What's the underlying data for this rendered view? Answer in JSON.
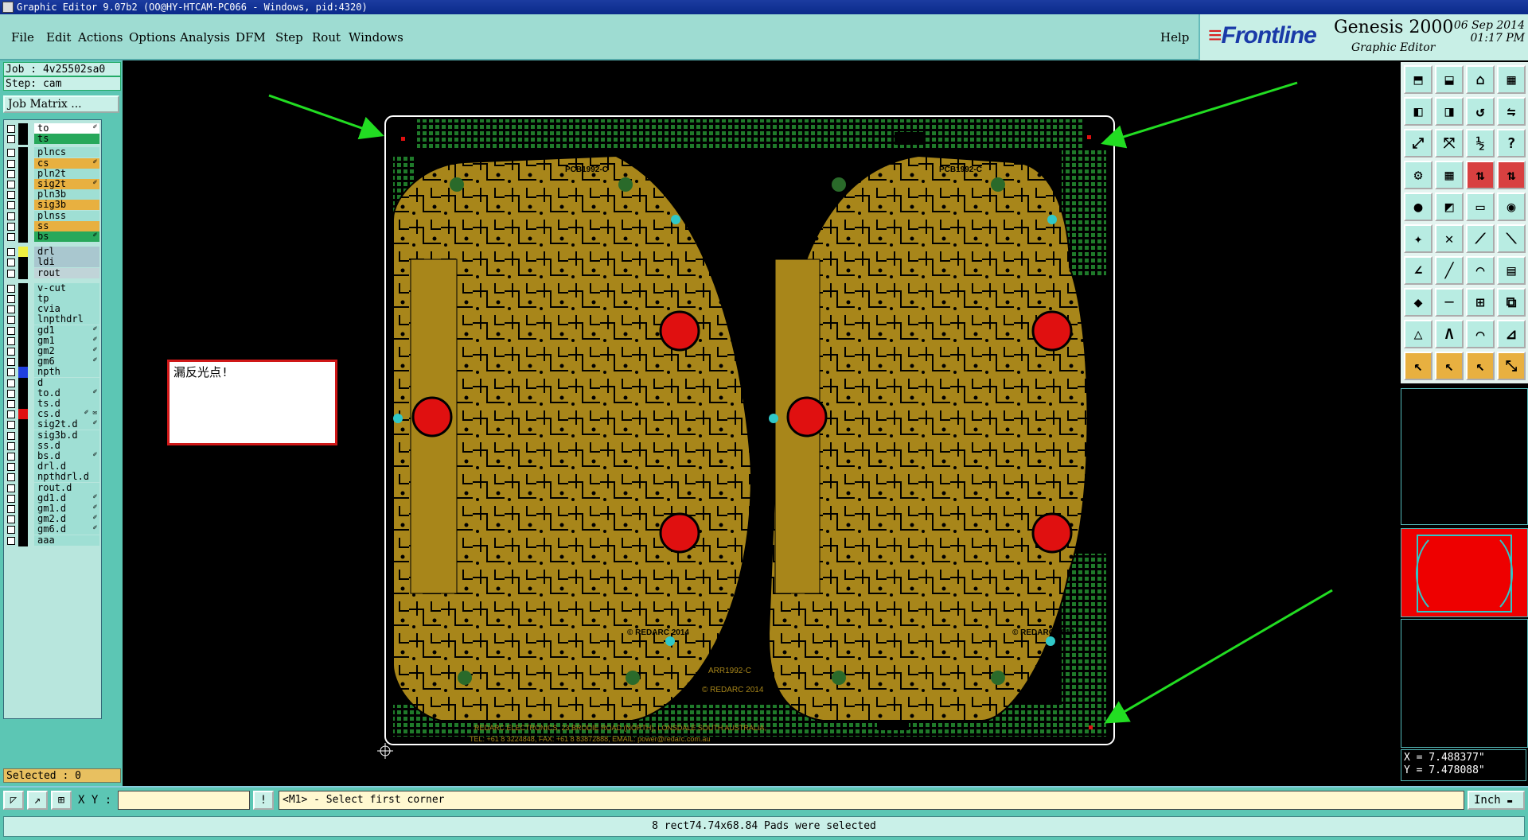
{
  "window": {
    "title": "Graphic Editor 9.07b2 (OO@HY-HTCAM-PC066 - Windows, pid:4320)"
  },
  "menu": {
    "items": [
      "File",
      "Edit",
      "Actions",
      "Options",
      "Analysis",
      "DFM",
      "Step",
      "Rout",
      "Windows"
    ],
    "help": "Help"
  },
  "brand": {
    "logo": "Frontline",
    "product": "Genesis 2000",
    "subtitle": "Graphic Editor",
    "date": "06 Sep 2014",
    "time": "01:17 PM"
  },
  "job": {
    "job_line": "Job : 4v25502sa0",
    "step_line": "Step: cam",
    "matrix_button": "Job Matrix ..."
  },
  "layers": [
    {
      "name": "to",
      "color": "#ffffff",
      "edit": "✐",
      "swatch": "#000000"
    },
    {
      "name": "ts",
      "color": "#27a85b",
      "edit": "",
      "swatch": "#000000"
    },
    {
      "name": "plncs",
      "color": "#9fdfd4",
      "edit": "",
      "swatch": "#000000"
    },
    {
      "name": "cs",
      "color": "#e8b040",
      "edit": "✐",
      "swatch": "#000000"
    },
    {
      "name": "pln2t",
      "color": "#9fdfd4",
      "edit": "",
      "swatch": "#000000"
    },
    {
      "name": "sig2t",
      "color": "#e8b040",
      "edit": "✐",
      "swatch": "#000000"
    },
    {
      "name": "pln3b",
      "color": "#9fdfd4",
      "edit": "",
      "swatch": "#000000"
    },
    {
      "name": "sig3b",
      "color": "#e8b040",
      "edit": "",
      "swatch": "#000000"
    },
    {
      "name": "plnss",
      "color": "#9fdfd4",
      "edit": "",
      "swatch": "#000000"
    },
    {
      "name": "ss",
      "color": "#e8b040",
      "edit": "",
      "swatch": "#000000"
    },
    {
      "name": "bs",
      "color": "#27a85b",
      "edit": "✐",
      "swatch": "#000000"
    },
    {
      "name": "drl",
      "color": "#a9c7cf",
      "edit": "",
      "swatch": "#f0f040"
    },
    {
      "name": "ldi",
      "color": "#a9c7cf",
      "edit": "",
      "swatch": "#000000"
    },
    {
      "name": "rout",
      "color": "#c0d4d8",
      "edit": "",
      "swatch": "#000000"
    },
    {
      "name": "v-cut",
      "color": "#9fdfd4",
      "edit": "",
      "swatch": "#000000"
    },
    {
      "name": "tp",
      "color": "#9fdfd4",
      "edit": "",
      "swatch": "#000000"
    },
    {
      "name": "cvia",
      "color": "#9fdfd4",
      "edit": "",
      "swatch": "#000000"
    },
    {
      "name": "lnpthdrl",
      "color": "#9fdfd4",
      "edit": "",
      "swatch": "#000000"
    },
    {
      "name": "gd1",
      "color": "#9fdfd4",
      "edit": "✐",
      "swatch": "#000000"
    },
    {
      "name": "gm1",
      "color": "#9fdfd4",
      "edit": "✐",
      "swatch": "#000000"
    },
    {
      "name": "gm2",
      "color": "#9fdfd4",
      "edit": "✐",
      "swatch": "#000000"
    },
    {
      "name": "gm6",
      "color": "#9fdfd4",
      "edit": "✐",
      "swatch": "#000000"
    },
    {
      "name": "npth",
      "color": "#9fdfd4",
      "edit": "",
      "swatch": "#1f3fe0"
    },
    {
      "name": "d",
      "color": "#9fdfd4",
      "edit": "",
      "swatch": "#000000"
    },
    {
      "name": "to.d",
      "color": "#9fdfd4",
      "edit": "✐",
      "swatch": "#000000"
    },
    {
      "name": "ts.d",
      "color": "#9fdfd4",
      "edit": "",
      "swatch": "#000000"
    },
    {
      "name": "cs.d",
      "color": "#9fdfd4",
      "edit": "✐ ✉",
      "swatch": "#e01010"
    },
    {
      "name": "sig2t.d",
      "color": "#9fdfd4",
      "edit": "✐",
      "swatch": "#000000"
    },
    {
      "name": "sig3b.d",
      "color": "#9fdfd4",
      "edit": "",
      "swatch": "#000000"
    },
    {
      "name": "ss.d",
      "color": "#9fdfd4",
      "edit": "",
      "swatch": "#000000"
    },
    {
      "name": "bs.d",
      "color": "#9fdfd4",
      "edit": "✐",
      "swatch": "#000000"
    },
    {
      "name": "drl.d",
      "color": "#9fdfd4",
      "edit": "",
      "swatch": "#000000"
    },
    {
      "name": "npthdrl.d",
      "color": "#9fdfd4",
      "edit": "",
      "swatch": "#000000"
    },
    {
      "name": "rout.d",
      "color": "#9fdfd4",
      "edit": "",
      "swatch": "#000000"
    },
    {
      "name": "gd1.d",
      "color": "#9fdfd4",
      "edit": "✐",
      "swatch": "#000000"
    },
    {
      "name": "gm1.d",
      "color": "#9fdfd4",
      "edit": "✐",
      "swatch": "#000000"
    },
    {
      "name": "gm2.d",
      "color": "#9fdfd4",
      "edit": "✐",
      "swatch": "#000000"
    },
    {
      "name": "gm6.d",
      "color": "#9fdfd4",
      "edit": "✐",
      "swatch": "#000000"
    },
    {
      "name": "aaa",
      "color": "#9fdfd4",
      "edit": "",
      "swatch": "#000000"
    }
  ],
  "selected": "Selected : 0",
  "note": "漏反光点!",
  "board": {
    "label_left": "PCB1992-C",
    "label_right": "PCB1992-C",
    "copyright_left": "© REDARC 2014",
    "copyright_right": "© REDARC 2014",
    "center_label": "ARR1992-C",
    "center_copyright": "© REDARC 2014",
    "address_line1": "REDARC ELECTRONICS, 23 BRODIE ROAD (NORTH), LONSDALE SOUTH AUSTRALIA,",
    "address_line2": "TEL: +61 8 3224848, FAX: +61 8 83872888, EMAIL: power@redarc.com.au",
    "colors": {
      "copper": "#a8861a",
      "mask": "#1f7a2a",
      "pad": "#e01010",
      "outline": "#ffffff",
      "arrow": "#22dd22"
    }
  },
  "coords": {
    "x": "X = 7.488377\"",
    "y": "Y = 7.478088\""
  },
  "bottom": {
    "xy_label": "X Y :",
    "xy_value": "",
    "prompt": "<M1> - Select first corner",
    "unit": "Inch"
  },
  "status": "8 rect74.74x68.84 Pads were selected",
  "icons": {
    "bottom": [
      "zoom-area-icon",
      "zoom-line-icon",
      "grid-icon"
    ],
    "info": "info-icon"
  }
}
